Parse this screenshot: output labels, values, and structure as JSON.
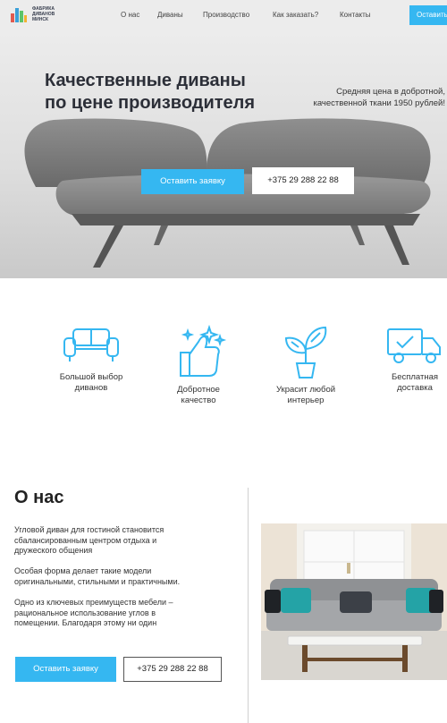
{
  "header": {
    "logo_text": [
      "ФАБРИКА",
      "ДИВАНОВ",
      "МИНСК"
    ],
    "nav": [
      "О нас",
      "Диваны",
      "Производство",
      "Как заказать?",
      "Контакты"
    ],
    "button_label": "Оставить заявку"
  },
  "hero": {
    "title_lines": [
      "Качественные диваны",
      "по цене производителя"
    ],
    "subtitle_lines": [
      "Средняя цена в добротной,",
      "качественной ткани 1950 рублей!"
    ],
    "cta_label": "Оставить заявку",
    "phone": "+375 29 288 22 88"
  },
  "features": [
    {
      "icon": "sofa-icon",
      "label_lines": [
        "Большой выбор",
        "диванов"
      ]
    },
    {
      "icon": "thumbs-up-icon",
      "label_lines": [
        "Добротное",
        "качество"
      ]
    },
    {
      "icon": "plant-icon",
      "label_lines": [
        "Украсит любой",
        "интерьер"
      ]
    },
    {
      "icon": "delivery-truck-icon",
      "label_lines": [
        "Бесплатная",
        "доставка"
      ]
    }
  ],
  "about": {
    "title": "О нас",
    "paragraphs": [
      [
        "Угловой диван для гостиной становится",
        "сбалансированным центром отдыха и",
        "дружеского общения"
      ],
      [
        "Особая форма делает такие модели",
        "оригинальными, стильными и практичными."
      ],
      [
        "Одно из ключевых преимуществ мебели –",
        "рациональное использование углов в",
        "помещении. Благодаря этому ни один"
      ]
    ],
    "cta_label": "Оставить заявку",
    "phone": "+375 29 288 22 88"
  },
  "colors": {
    "accent": "#35b7f1",
    "text": "#2c2f38"
  }
}
